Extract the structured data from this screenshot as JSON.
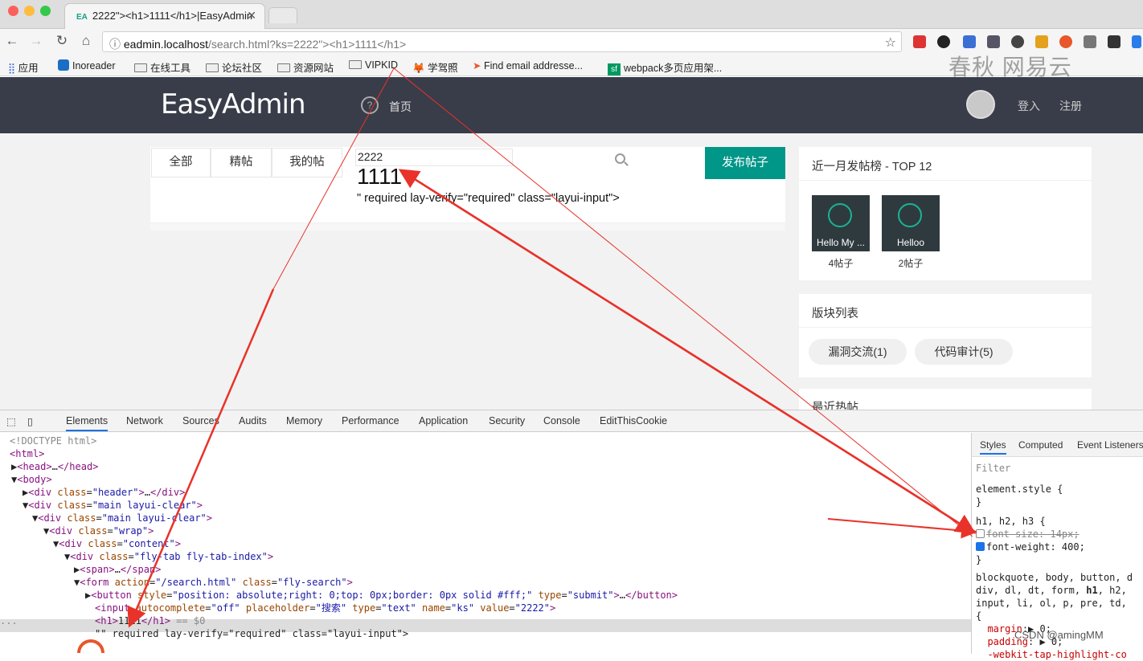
{
  "browser": {
    "tab_title": "2222\"><h1>1111</h1>|EasyAdmin",
    "tab_favicon": "EA",
    "url_host": "eadmin.localhost",
    "url_rest": "/search.html?ks=2222\"><h1>1111</h1>",
    "bookmarks": [
      "应用",
      "Inoreader",
      "在线工具",
      "论坛社区",
      "资源网站",
      "VIPKID",
      "学驾照",
      "Find email addresse...",
      "webpack多页应用架..."
    ]
  },
  "watermark": "春秋  网易云",
  "site": {
    "logo": "EasyAdmin",
    "home_label": "首页",
    "login_label": "登入",
    "register_label": "注册",
    "tabs": [
      "全部",
      "精帖",
      "我的帖"
    ],
    "search_value": "2222",
    "injected_h1": "1111",
    "injected_tail": "\" required lay-verify=\"required\" class=\"layui-input\">",
    "post_button": "发布帖子",
    "top_panel_title": "近一月发帖榜 - TOP 12",
    "users": [
      {
        "name": "Hello My ...",
        "count": "4帖子"
      },
      {
        "name": "Helloo",
        "count": "2帖子"
      }
    ],
    "board_panel_title": "版块列表",
    "boards": [
      "漏洞交流(1)",
      "代码审计(5)"
    ],
    "recent_panel_title": "最近热帖"
  },
  "devtools": {
    "tabs": [
      "Elements",
      "Network",
      "Sources",
      "Audits",
      "Memory",
      "Performance",
      "Application",
      "Security",
      "Console",
      "EditThisCookie"
    ],
    "style_tabs": [
      "Styles",
      "Computed",
      "Event Listeners"
    ],
    "filter_placeholder": "Filter"
  },
  "credit": "CSDN @amingMM",
  "colors": {
    "header": "#393d49",
    "accent": "#009688",
    "arrow": "#e8322a"
  }
}
